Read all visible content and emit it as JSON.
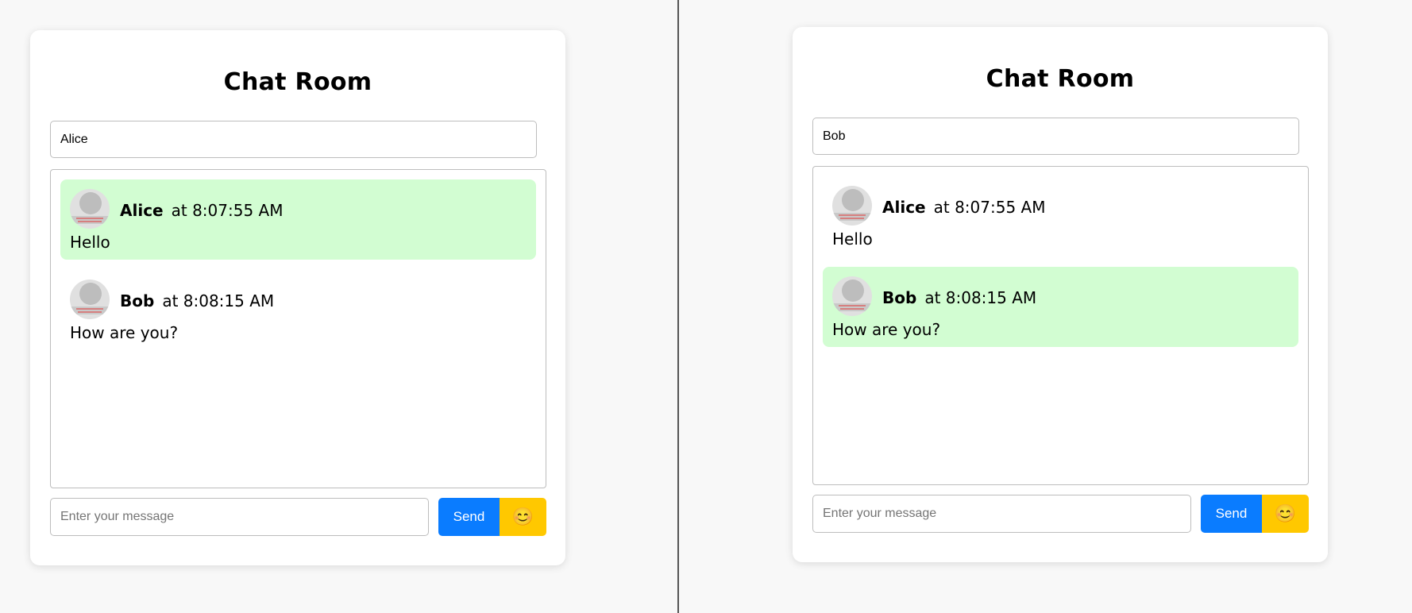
{
  "colors": {
    "own_message_bg": "#d2fdd2",
    "send_button": "#0a7cff",
    "emoji_button": "#ffc800"
  },
  "left_window": {
    "title": "Chat Room",
    "username_value": "Alice",
    "messages": [
      {
        "user": "Alice",
        "time": "at 8:07:55 AM",
        "text": "Hello",
        "own": true
      },
      {
        "user": "Bob",
        "time": "at 8:08:15 AM",
        "text": "How are you?",
        "own": false
      }
    ],
    "composer": {
      "placeholder": "Enter your message",
      "send_label": "Send",
      "emoji_icon": "😊"
    }
  },
  "right_window": {
    "title": "Chat Room",
    "username_value": "Bob",
    "messages": [
      {
        "user": "Alice",
        "time": "at 8:07:55 AM",
        "text": "Hello",
        "own": false
      },
      {
        "user": "Bob",
        "time": "at 8:08:15 AM",
        "text": "How are you?",
        "own": true
      }
    ],
    "composer": {
      "placeholder": "Enter your message",
      "send_label": "Send",
      "emoji_icon": "😊"
    }
  }
}
